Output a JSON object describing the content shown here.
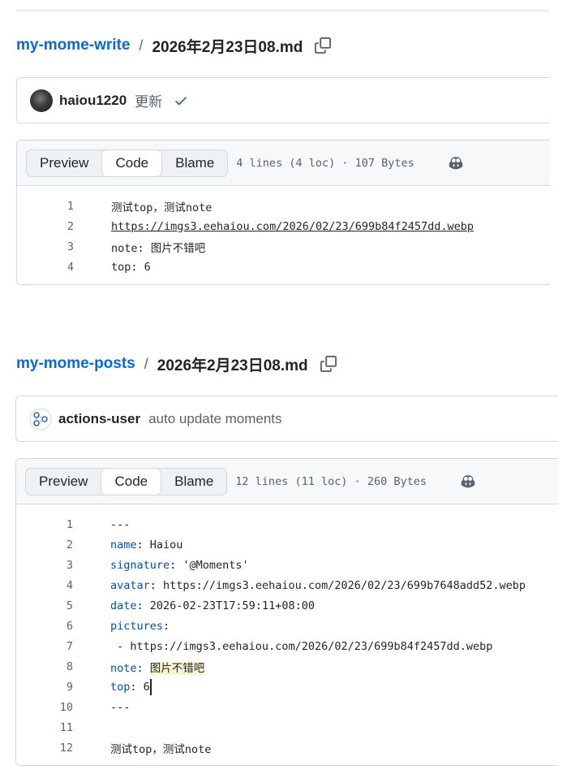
{
  "section1": {
    "repo": "my-mome-write",
    "separator": "/",
    "filename": "2026年2月23日08.md",
    "commit": {
      "author": "haiou1220",
      "message": "更新",
      "status": "check-icon"
    },
    "tabs": [
      "Preview",
      "Code",
      "Blame"
    ],
    "active_tab": "Code",
    "meta": "4 lines (4 loc) · 107 Bytes",
    "lines": [
      {
        "n": "1",
        "text": "测试top，测试note"
      },
      {
        "n": "2",
        "text": "https://imgs3.eehaiou.com/2026/02/23/699b84f2457dd.webp"
      },
      {
        "n": "3",
        "text": "note: 图片不错吧"
      },
      {
        "n": "4",
        "text": "top: 6"
      }
    ]
  },
  "section2": {
    "repo": "my-mome-posts",
    "separator": "/",
    "filename": "2026年2月23日08.md",
    "commit": {
      "author": "actions-user",
      "message": "auto update moments"
    },
    "tabs": [
      "Preview",
      "Code",
      "Blame"
    ],
    "active_tab": "Code",
    "meta": "12 lines (11 loc) · 260 Bytes",
    "lines": [
      {
        "n": "1",
        "text": "---"
      },
      {
        "n": "2",
        "key": "name",
        "rest": ": Haiou"
      },
      {
        "n": "3",
        "key": "signature",
        "rest": ": '@Moments'"
      },
      {
        "n": "4",
        "key": "avatar",
        "rest": ": https://imgs3.eehaiou.com/2026/02/23/699b7648add52.webp"
      },
      {
        "n": "5",
        "key": "date",
        "rest": ": 2026-02-23T17:59:11+08:00"
      },
      {
        "n": "6",
        "key": "pictures",
        "rest": ":"
      },
      {
        "n": "7",
        "text": " - https://imgs3.eehaiou.com/2026/02/23/699b84f2457dd.webp"
      },
      {
        "n": "8",
        "key": "note",
        "rest": ": ",
        "hl": "图片不错吧"
      },
      {
        "n": "9",
        "key": "top",
        "rest": ": 6"
      },
      {
        "n": "10",
        "text": "---"
      },
      {
        "n": "11",
        "text": ""
      },
      {
        "n": "12",
        "text": "测试top，测试note"
      }
    ]
  },
  "colors": {
    "link": "#0969da",
    "yaml_key": "#0550ae",
    "success": "#1a7f37",
    "border": "#d1d9e0"
  }
}
